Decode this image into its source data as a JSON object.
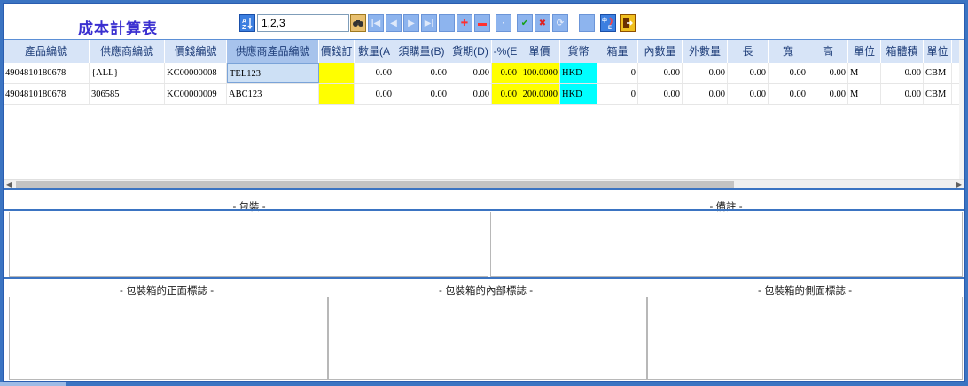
{
  "app": {
    "title": "成本計算表"
  },
  "toolbar": {
    "sort_value": "1,2,3"
  },
  "grid": {
    "columns": [
      "產品編號",
      "供應商編號",
      "價錢編號",
      "供應商產品編號",
      "價錢訂",
      "數量(A",
      "須購量(B)",
      "貨期(D)",
      "-%(E",
      "單價",
      "貨幣",
      "箱量",
      "內數量",
      "外數量",
      "長",
      "寬",
      "高",
      "單位",
      "箱體積",
      "單位"
    ],
    "rows": [
      [
        "4904810180678",
        "{ALL}",
        "KC00000008",
        "TEL123",
        "",
        "0.00",
        "0.00",
        "0.00",
        "0.00",
        "100.0000",
        "HKD",
        "0",
        "0.00",
        "0.00",
        "0.00",
        "0.00",
        "0.00",
        "M",
        "0.00",
        "CBM"
      ],
      [
        "4904810180678",
        "306585",
        "KC00000009",
        "ABC123",
        "",
        "0.00",
        "0.00",
        "0.00",
        "0.00",
        "200.0000",
        "HKD",
        "0",
        "0.00",
        "0.00",
        "0.00",
        "0.00",
        "0.00",
        "M",
        "0.00",
        "CBM"
      ]
    ]
  },
  "panels": {
    "packing": "- 包裝 -",
    "remarks": "- 備註 -",
    "front_mark": "- 包裝箱的正面標誌 -",
    "inner_mark": "- 包裝箱的內部標誌 -",
    "side_mark": "- 包裝箱的側面標誌 -"
  },
  "colors": {
    "accent": "#3b74c2",
    "highlight_yellow": "#ffff00",
    "highlight_cyan": "#00ffff",
    "title": "#3a2fd0"
  }
}
